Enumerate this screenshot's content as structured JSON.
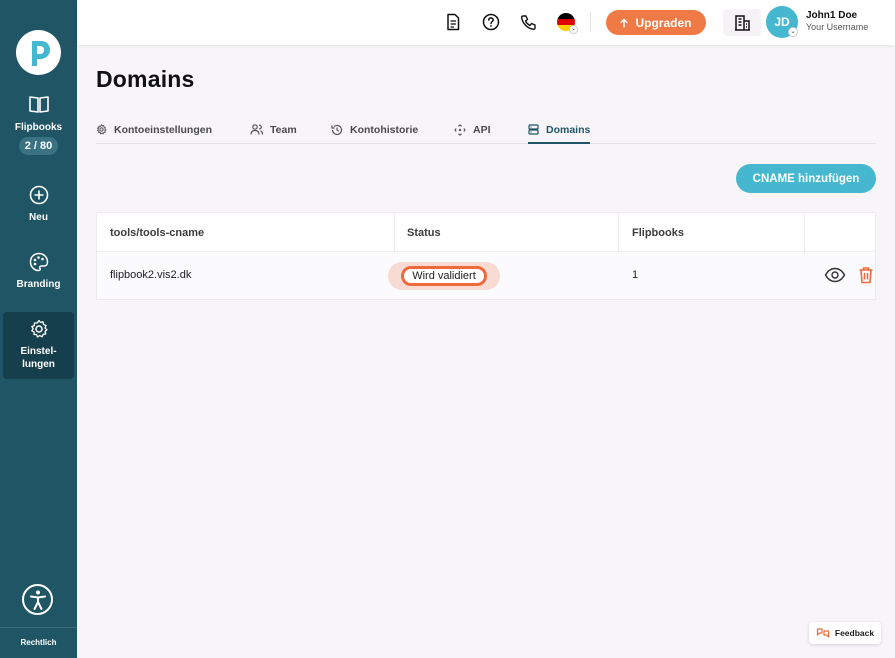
{
  "sidebar": {
    "items": [
      {
        "label": "Flipbooks",
        "icon": "book-open-icon",
        "badge": "2 / 80"
      },
      {
        "label": "Neu",
        "icon": "plus-circle-icon"
      },
      {
        "label": "Branding",
        "icon": "palette-icon"
      },
      {
        "label": "Einstel-\nlungen",
        "icon": "gear-icon"
      }
    ],
    "footer_link": "Rechtlich"
  },
  "topbar": {
    "upgrade_label": "Upgraden",
    "user_initials": "JD",
    "user_name": "John1 Doe",
    "user_subtitle": "Your Username",
    "language": "de"
  },
  "page": {
    "title": "Domains",
    "tabs": [
      {
        "label": "Kontoeinstellungen",
        "icon": "gear-icon"
      },
      {
        "label": "Team",
        "icon": "users-icon"
      },
      {
        "label": "Kontohistorie",
        "icon": "history-icon"
      },
      {
        "label": "API",
        "icon": "api-icon"
      },
      {
        "label": "Domains",
        "icon": "server-icon",
        "active": true
      }
    ],
    "add_button": "CNAME hinzufügen"
  },
  "table": {
    "headers": [
      "tools/tools-cname",
      "Status",
      "Flipbooks",
      ""
    ],
    "rows": [
      {
        "domain": "flipbook2.vis2.dk",
        "status": "Wird validiert",
        "flipbooks": "1"
      }
    ]
  },
  "feedback_label": "Feedback",
  "colors": {
    "sidebar": "#1f5565",
    "accent": "#45b8d0",
    "upgrade": "#f07a45",
    "status_border": "#ec6a3c"
  }
}
